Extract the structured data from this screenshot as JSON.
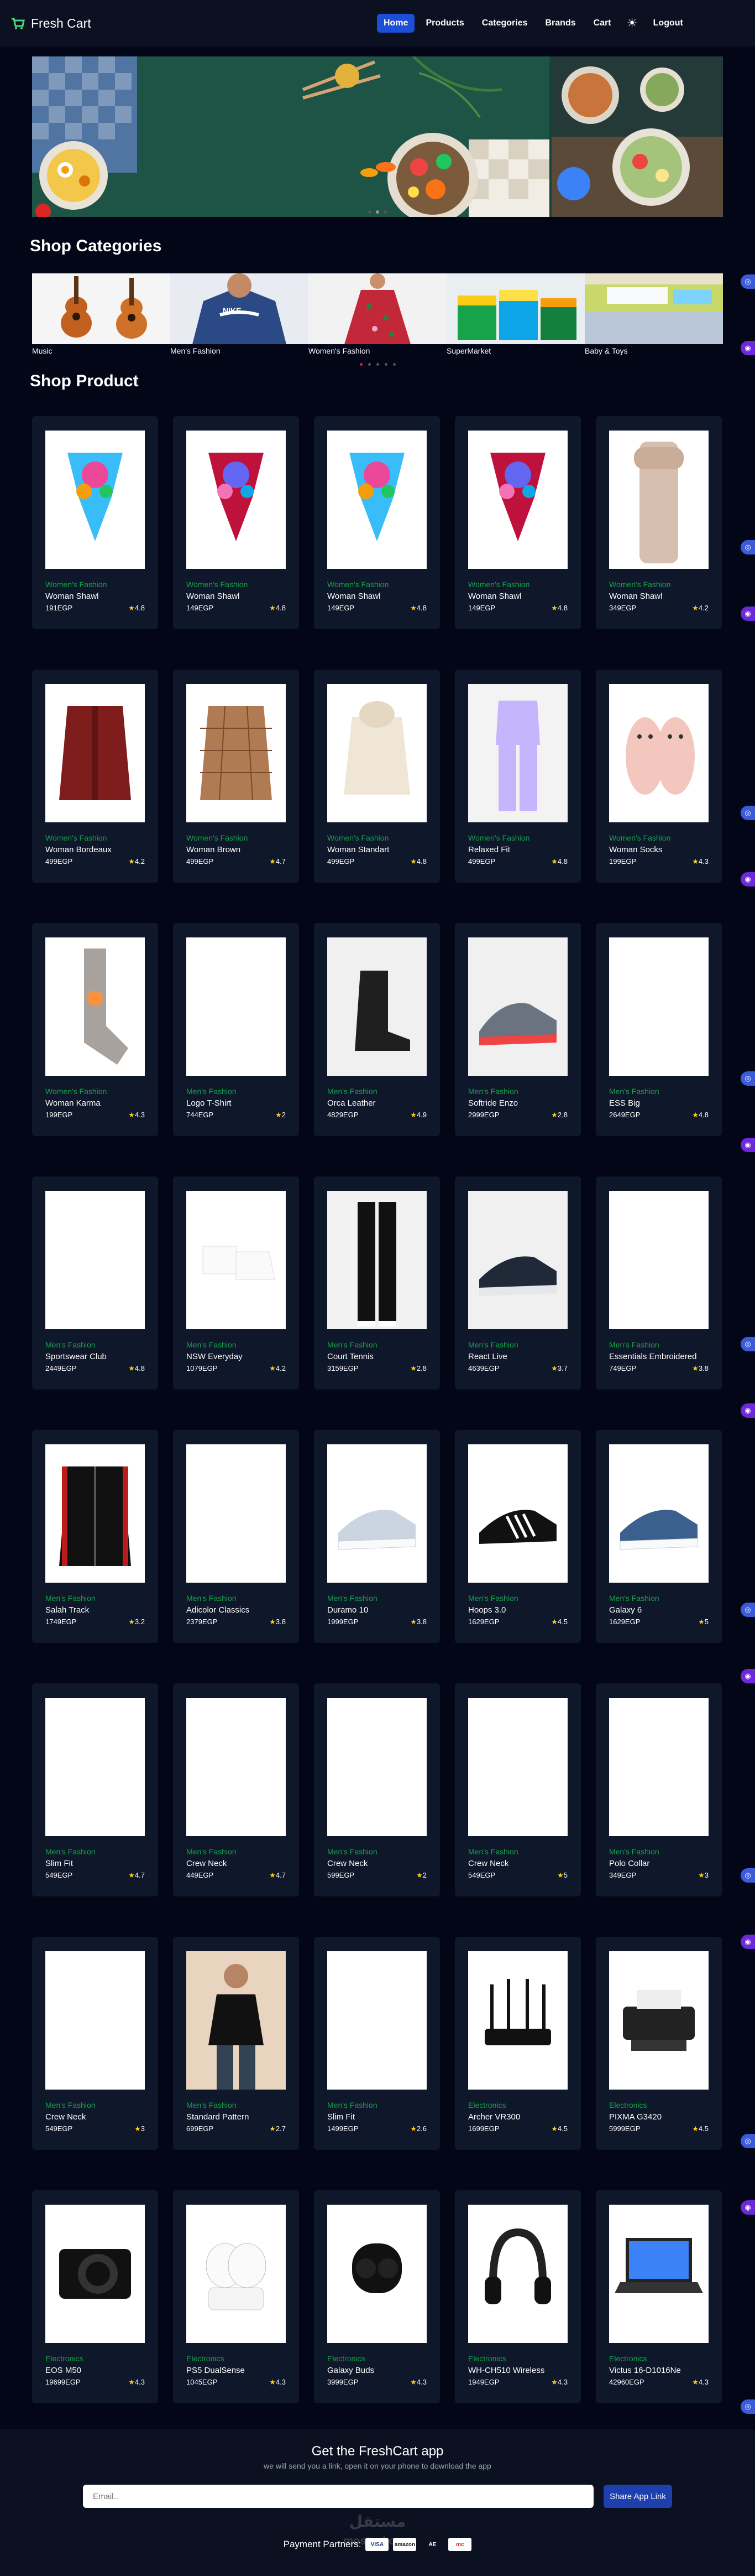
{
  "brand": {
    "name": "Fresh Cart"
  },
  "nav": {
    "links": [
      {
        "label": "Home",
        "active": true
      },
      {
        "label": "Products"
      },
      {
        "label": "Categories"
      },
      {
        "label": "Brands"
      },
      {
        "label": "Cart"
      },
      {
        "label": "Logout"
      }
    ],
    "theme_icon": "sun-icon"
  },
  "sections": {
    "categories_title": "Shop Categories",
    "products_title": "Shop Product"
  },
  "categories": [
    {
      "label": "Music"
    },
    {
      "label": "Men's Fashion"
    },
    {
      "label": "Women's Fashion"
    },
    {
      "label": "SuperMarket"
    },
    {
      "label": "Baby & Toys"
    }
  ],
  "products": [
    {
      "category": "Women's Fashion",
      "title": "Woman Shawl",
      "price": "191EGP",
      "rating": "4.8",
      "kind": "scarf-teal"
    },
    {
      "category": "Women's Fashion",
      "title": "Woman Shawl",
      "price": "149EGP",
      "rating": "4.8",
      "kind": "scarf-red"
    },
    {
      "category": "Women's Fashion",
      "title": "Woman Shawl",
      "price": "149EGP",
      "rating": "4.8",
      "kind": "scarf-teal"
    },
    {
      "category": "Women's Fashion",
      "title": "Woman Shawl",
      "price": "149EGP",
      "rating": "4.8",
      "kind": "scarf-red"
    },
    {
      "category": "Women's Fashion",
      "title": "Woman Shawl",
      "price": "349EGP",
      "rating": "4.2",
      "kind": "beige-scarf"
    },
    {
      "category": "Women's Fashion",
      "title": "Woman Bordeaux",
      "price": "499EGP",
      "rating": "4.2",
      "kind": "shirt-bordeaux"
    },
    {
      "category": "Women's Fashion",
      "title": "Woman Brown",
      "price": "499EGP",
      "rating": "4.7",
      "kind": "shirt-brown"
    },
    {
      "category": "Women's Fashion",
      "title": "Woman Standart",
      "price": "499EGP",
      "rating": "4.8",
      "kind": "hoodie-cream"
    },
    {
      "category": "Women's Fashion",
      "title": "Relaxed Fit",
      "price": "499EGP",
      "rating": "4.8",
      "kind": "lilac-set"
    },
    {
      "category": "Women's Fashion",
      "title": "Woman Socks",
      "price": "199EGP",
      "rating": "4.3",
      "kind": "slippers"
    },
    {
      "category": "Women's Fashion",
      "title": "Woman Karma",
      "price": "199EGP",
      "rating": "4.3",
      "kind": "sock"
    },
    {
      "category": "Men's Fashion",
      "title": "Logo T-Shirt",
      "price": "744EGP",
      "rating": "2",
      "kind": "tee-green"
    },
    {
      "category": "Men's Fashion",
      "title": "Orca Leather",
      "price": "4829EGP",
      "rating": "4.9",
      "kind": "boot"
    },
    {
      "category": "Men's Fashion",
      "title": "Softride Enzo",
      "price": "2999EGP",
      "rating": "2.8",
      "kind": "sneaker-grey"
    },
    {
      "category": "Men's Fashion",
      "title": "ESS Big",
      "price": "2649EGP",
      "rating": "4.8",
      "kind": "hoodie-black"
    },
    {
      "category": "Men's Fashion",
      "title": "Sportswear Club",
      "price": "2449EGP",
      "rating": "4.8",
      "kind": "tracksuit-navy"
    },
    {
      "category": "Men's Fashion",
      "title": "NSW Everyday",
      "price": "1079EGP",
      "rating": "4.2",
      "kind": "socks-white"
    },
    {
      "category": "Men's Fashion",
      "title": "Court Tennis",
      "price": "3159EGP",
      "rating": "2.8",
      "kind": "pants-black"
    },
    {
      "category": "Men's Fashion",
      "title": "React Live",
      "price": "4639EGP",
      "rating": "3.7",
      "kind": "sneaker-black"
    },
    {
      "category": "Men's Fashion",
      "title": "Essentials Embroidered",
      "price": "749EGP",
      "rating": "3.8",
      "kind": "tee-navy"
    },
    {
      "category": "Men's Fashion",
      "title": "Salah Track",
      "price": "1749EGP",
      "rating": "3.2",
      "kind": "jacket-black"
    },
    {
      "category": "Men's Fashion",
      "title": "Adicolor Classics",
      "price": "2379EGP",
      "rating": "3.8",
      "kind": "jacket-navy"
    },
    {
      "category": "Men's Fashion",
      "title": "Duramo 10",
      "price": "1999EGP",
      "rating": "3.8",
      "kind": "sneaker-white"
    },
    {
      "category": "Men's Fashion",
      "title": "Hoops 3.0",
      "price": "1629EGP",
      "rating": "4.5",
      "kind": "sneaker-stripes"
    },
    {
      "category": "Men's Fashion",
      "title": "Galaxy 6",
      "price": "1629EGP",
      "rating": "5",
      "kind": "sneaker-blue"
    },
    {
      "category": "Men's Fashion",
      "title": "Slim Fit",
      "price": "549EGP",
      "rating": "4.7",
      "kind": "shirt-lightblue"
    },
    {
      "category": "Men's Fashion",
      "title": "Crew Neck",
      "price": "449EGP",
      "rating": "4.7",
      "kind": "sweater-navy"
    },
    {
      "category": "Men's Fashion",
      "title": "Crew Neck",
      "price": "599EGP",
      "rating": "2",
      "kind": "sweater-stripe"
    },
    {
      "category": "Men's Fashion",
      "title": "Crew Neck",
      "price": "549EGP",
      "rating": "5",
      "kind": "sweater-burgundy"
    },
    {
      "category": "Men's Fashion",
      "title": "Polo Collar",
      "price": "349EGP",
      "rating": "3",
      "kind": "polo-green"
    },
    {
      "category": "Men's Fashion",
      "title": "Crew Neck",
      "price": "549EGP",
      "rating": "3",
      "kind": "sweater-blue-stripe"
    },
    {
      "category": "Men's Fashion",
      "title": "Standard Pattern",
      "price": "699EGP",
      "rating": "2.7",
      "kind": "pajama"
    },
    {
      "category": "Men's Fashion",
      "title": "Slim Fit",
      "price": "1499EGP",
      "rating": "2.6",
      "kind": "leather-jacket"
    },
    {
      "category": "Electronics",
      "title": "Archer VR300",
      "price": "1699EGP",
      "rating": "4.5",
      "kind": "router"
    },
    {
      "category": "Electronics",
      "title": "PIXMA G3420",
      "price": "5999EGP",
      "rating": "4.5",
      "kind": "printer"
    },
    {
      "category": "Electronics",
      "title": "EOS M50",
      "price": "19699EGP",
      "rating": "4.3",
      "kind": "camera"
    },
    {
      "category": "Electronics",
      "title": "PS5 DualSense",
      "price": "1045EGP",
      "rating": "4.3",
      "kind": "charger"
    },
    {
      "category": "Electronics",
      "title": "Galaxy Buds",
      "price": "3999EGP",
      "rating": "4.3",
      "kind": "buds"
    },
    {
      "category": "Electronics",
      "title": "WH-CH510 Wireless",
      "price": "1949EGP",
      "rating": "4.3",
      "kind": "headphones"
    },
    {
      "category": "Electronics",
      "title": "Victus 16-D1016Ne",
      "price": "42960EGP",
      "rating": "4.3",
      "kind": "laptop"
    }
  ],
  "footer": {
    "title": "Get the FreshCart app",
    "subtitle": "we will send you a link, open it on your phone to download the app",
    "email_placeholder": "Email..",
    "button_label": "Share App Link",
    "payment_label": "Payment Partners:",
    "payments": [
      "VISA",
      "amazon",
      "AE",
      "mc"
    ],
    "watermark": "مستقل mostaql.com"
  },
  "colors": {
    "accent": "#1d4ed8",
    "category_green": "#16a34a",
    "star": "#facc15",
    "card_bg": "#0f172a",
    "page_bg": "#020617"
  }
}
